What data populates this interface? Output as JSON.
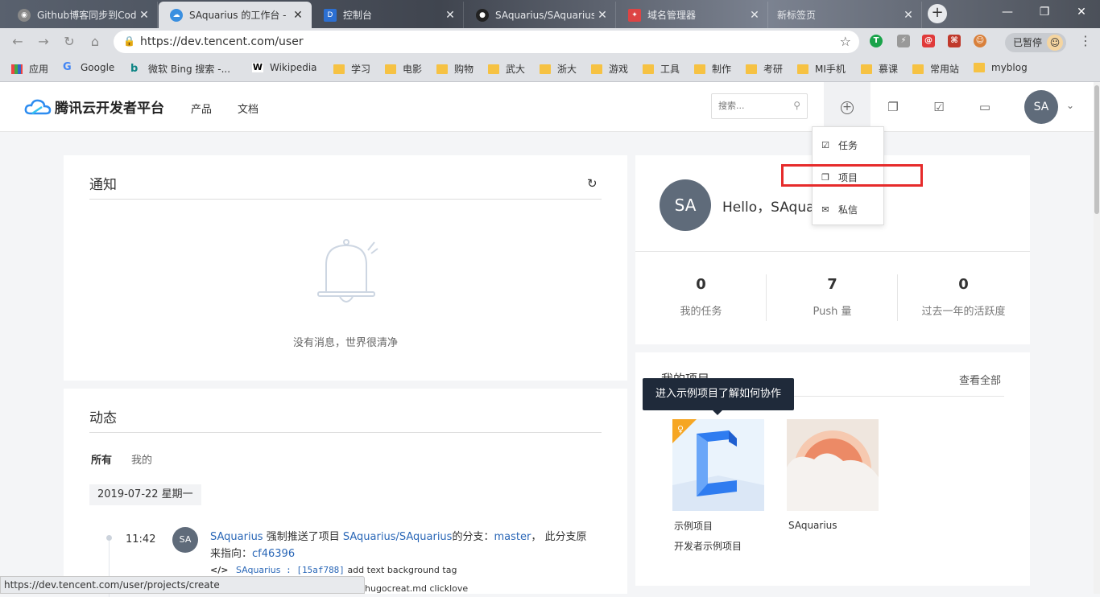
{
  "browser": {
    "tabs": [
      {
        "title": "Github博客同步到Cod",
        "active": false,
        "icon": "globe-icon"
      },
      {
        "title": "SAquarius 的工作台 - (",
        "active": true,
        "icon": "tencent-cloud-icon"
      },
      {
        "title": "控制台",
        "active": false,
        "icon": "d-logo-icon"
      },
      {
        "title": "SAquarius/SAquarius",
        "active": false,
        "icon": "github-icon"
      },
      {
        "title": "域名管理器",
        "active": false,
        "icon": "domain-icon"
      },
      {
        "title": "新标签页",
        "active": false,
        "icon": ""
      }
    ],
    "url": "https://dev.tencent.com/user",
    "paused_label": "已暂停",
    "bookmarks": [
      "应用",
      "Google",
      "微软 Bing 搜索 -...",
      "Wikipedia",
      "学习",
      "电影",
      "购物",
      "武大",
      "浙大",
      "游戏",
      "工具",
      "制作",
      "考研",
      "MI手机",
      "慕课",
      "常用站",
      "myblog"
    ],
    "status_url": "https://dev.tencent.com/user/projects/create"
  },
  "header": {
    "logo_text": "腾讯云开发者平台",
    "nav": [
      "产品",
      "文档"
    ],
    "search_placeholder": "搜索...",
    "avatar_initials": "SA"
  },
  "dropdown": {
    "items": [
      "任务",
      "项目",
      "私信"
    ]
  },
  "notice": {
    "title": "通知",
    "empty_text": "没有消息，世界很清净"
  },
  "feed": {
    "title": "动态",
    "filters": [
      "所有",
      "我的"
    ],
    "date": "2019-07-22 星期一",
    "entry": {
      "time": "11:42",
      "avatar": "SA",
      "user": "SAquarius",
      "action": "强制推送了项目",
      "project": "SAquarius/SAquarius",
      "branch_prefix": "的分支：",
      "branch": "master",
      "after": "， 此分支原",
      "line2_prefix": "来指向：",
      "commit": "cf46396",
      "commit_user": "SAquarius",
      "commit_hash": "[15af788]",
      "commit_msg": "add text background tag",
      "commit2_msg": "hugocreat.md clicklove"
    }
  },
  "profile": {
    "avatar": "SA",
    "greeting": "Hello，SAqua",
    "stats": [
      {
        "value": "0",
        "label": "我的任务"
      },
      {
        "value": "7",
        "label": "Push 量"
      },
      {
        "value": "0",
        "label": "过去一年的活跃度"
      }
    ]
  },
  "projects": {
    "title": "我的项目",
    "view_all": "查看全部",
    "tooltip": "进入示例项目了解如何协作",
    "items": [
      {
        "name": "示例项目",
        "desc": "开发者示例项目"
      },
      {
        "name": "SAquarius",
        "desc": ""
      }
    ]
  }
}
